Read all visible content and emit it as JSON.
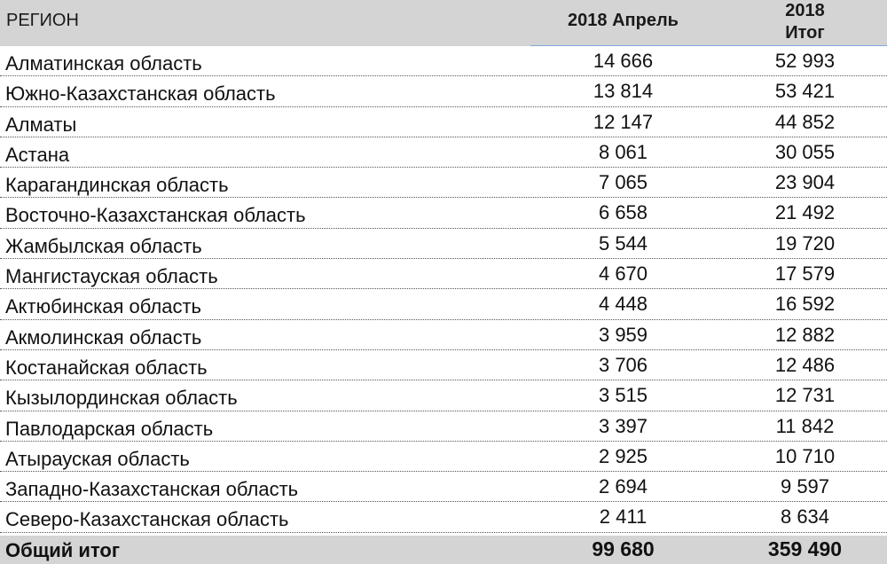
{
  "header": {
    "region": "РЕГИОН",
    "col1": "2018 Апрель",
    "col2_line1": "2018",
    "col2_line2": "Итог"
  },
  "rows": [
    {
      "region": "Алматинская область",
      "april": "14 666",
      "total": "52 993"
    },
    {
      "region": "Южно-Казахстанская область",
      "april": "13 814",
      "total": "53 421"
    },
    {
      "region": "Алматы",
      "april": "12 147",
      "total": "44 852"
    },
    {
      "region": "Астана",
      "april": "8 061",
      "total": "30 055"
    },
    {
      "region": "Карагандинская область",
      "april": "7 065",
      "total": "23 904"
    },
    {
      "region": "Восточно-Казахстанская область",
      "april": "6 658",
      "total": "21 492"
    },
    {
      "region": "Жамбылская область",
      "april": "5 544",
      "total": "19 720"
    },
    {
      "region": "Мангистауская область",
      "april": "4 670",
      "total": "17 579"
    },
    {
      "region": "Актюбинская область",
      "april": "4 448",
      "total": "16 592"
    },
    {
      "region": "Акмолинская область",
      "april": "3 959",
      "total": "12 882"
    },
    {
      "region": "Костанайская область",
      "april": "3 706",
      "total": "12 486"
    },
    {
      "region": "Кызылординская область",
      "april": "3 515",
      "total": "12 731"
    },
    {
      "region": "Павлодарская область",
      "april": "3 397",
      "total": "11 842"
    },
    {
      "region": "Атырауская область",
      "april": "2 925",
      "total": "10 710"
    },
    {
      "region": "Западно-Казахстанская область",
      "april": "2 694",
      "total": "9 597"
    },
    {
      "region": "Северо-Казахстанская область",
      "april": "2 411",
      "total": "8 634"
    }
  ],
  "grand_total": {
    "label": "Общий итог",
    "april": "99 680",
    "total": "359 490"
  }
}
